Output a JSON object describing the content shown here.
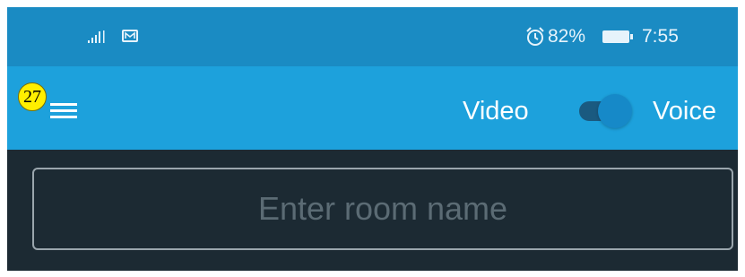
{
  "status_bar": {
    "signal_icon": "signal-icon",
    "message_icon": "message-icon",
    "alarm_icon": "alarm-icon",
    "battery_percent": "82%",
    "battery_icon": "battery-icon",
    "time": "7:55"
  },
  "app_bar": {
    "badge": "27",
    "menu_icon": "hamburger-menu-icon",
    "video_label": "Video",
    "voice_label": "Voice",
    "mode_toggle": {
      "state": "on",
      "selected": "Voice"
    }
  },
  "room": {
    "placeholder": "Enter room name",
    "value": ""
  },
  "colors": {
    "status_bar_bg": "#1a8bc3",
    "app_bar_bg": "#1da1dc",
    "content_bg": "#1c2a33",
    "input_border": "#9aa6ad",
    "placeholder_text": "#5b6b74",
    "badge_bg": "#ffef00"
  }
}
